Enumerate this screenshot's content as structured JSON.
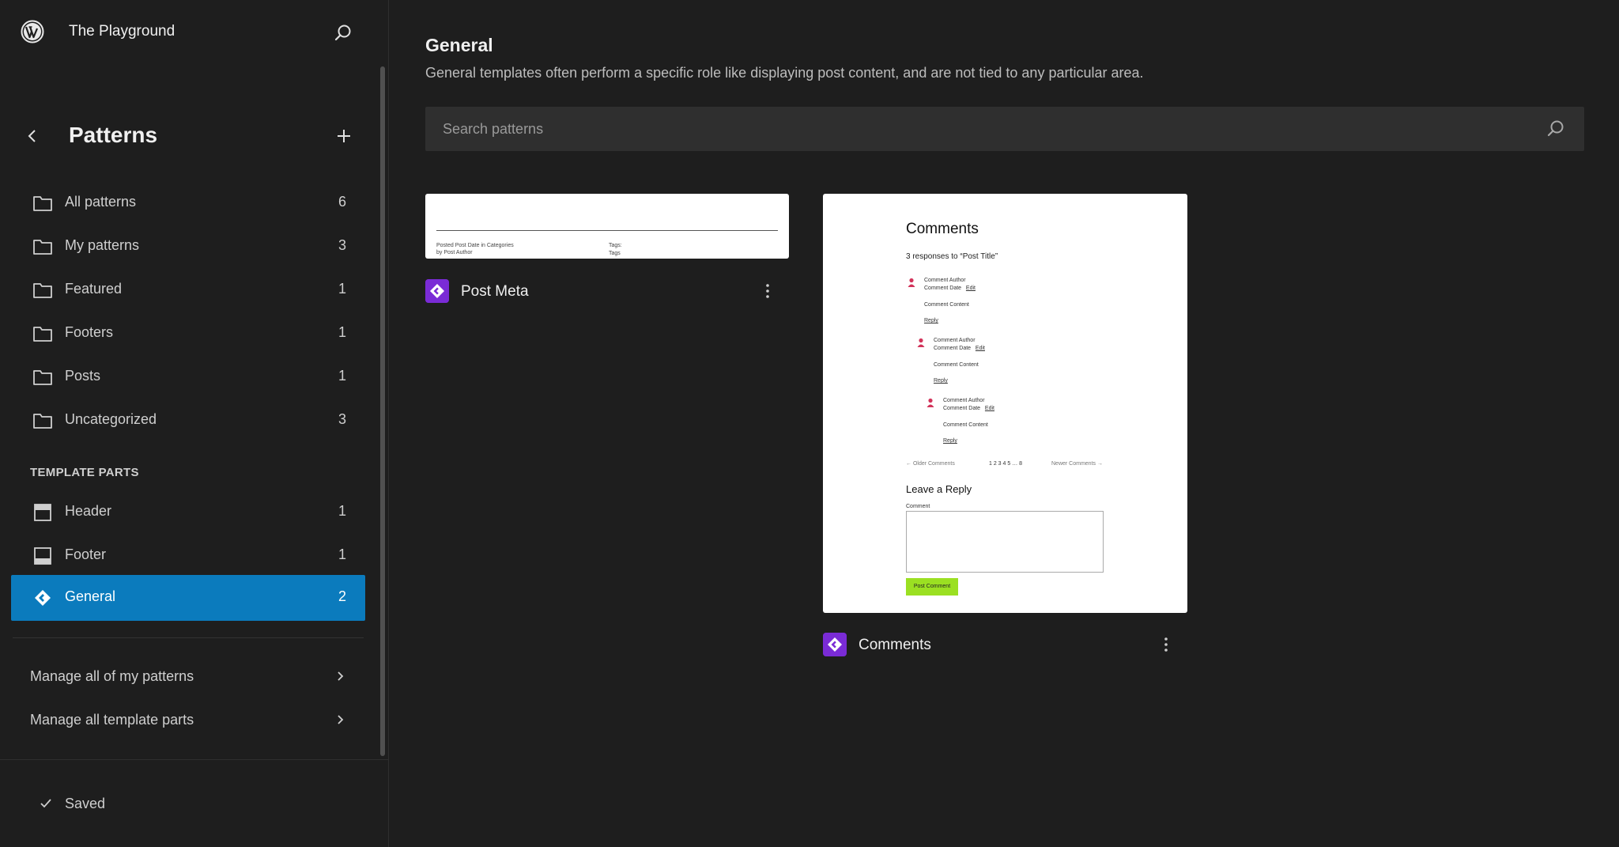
{
  "site": {
    "title": "The Playground"
  },
  "panel": {
    "title": "Patterns"
  },
  "nav": {
    "items": [
      {
        "label": "All patterns",
        "count": "6"
      },
      {
        "label": "My patterns",
        "count": "3"
      },
      {
        "label": "Featured",
        "count": "1"
      },
      {
        "label": "Footers",
        "count": "1"
      },
      {
        "label": "Posts",
        "count": "1"
      },
      {
        "label": "Uncategorized",
        "count": "3"
      }
    ],
    "template_parts_heading": "TEMPLATE PARTS",
    "template_parts": [
      {
        "label": "Header",
        "count": "1"
      },
      {
        "label": "Footer",
        "count": "1"
      },
      {
        "label": "General",
        "count": "2",
        "active": true
      }
    ],
    "manage": [
      {
        "label": "Manage all of my patterns"
      },
      {
        "label": "Manage all template parts"
      }
    ]
  },
  "status": {
    "saved_label": "Saved"
  },
  "main": {
    "title": "General",
    "description": "General templates often perform a specific role like displaying post content, and are not tied to any particular area.",
    "search_placeholder": "Search patterns",
    "cards": [
      {
        "title": "Post Meta",
        "preview": {
          "posted": "Posted",
          "post_date": "Post Date",
          "in": "in",
          "categories": "Categories",
          "by": "by",
          "post_author": "Post Author",
          "tags1": "Tags:",
          "tags2": "Tags"
        }
      },
      {
        "title": "Comments",
        "preview": {
          "heading": "Comments",
          "responses": "3 responses to “Post Title”",
          "comments": [
            {
              "author": "Comment Author",
              "date": "Comment Date",
              "edit": "Edit",
              "content": "Comment Content",
              "reply": "Reply"
            },
            {
              "author": "Comment Author",
              "date": "Comment Date",
              "edit": "Edit",
              "content": "Comment Content",
              "reply": "Reply"
            },
            {
              "author": "Comment Author",
              "date": "Comment Date",
              "edit": "Edit",
              "content": "Comment Content",
              "reply": "Reply"
            }
          ],
          "older": "← Older Comments",
          "pages": "1 2 3 4 5 … 8",
          "newer": "Newer Comments →",
          "leave_reply": "Leave a Reply",
          "comment_label": "Comment",
          "post_button": "Post Comment"
        }
      }
    ]
  },
  "colors": {
    "background": "#1e1e1e",
    "accent": "#0b7bbd",
    "pattern_icon": "#7a2bd6",
    "search_bg": "#2f2f2f",
    "post_button": "#9be022"
  },
  "icons": {
    "logo": "wordpress-logo",
    "hub_search": "search-icon",
    "back": "chevron-left-icon",
    "add": "plus-icon",
    "folder": "folder-icon",
    "header": "header-template-icon",
    "footer": "footer-template-icon",
    "pattern": "symbol-icon",
    "more": "more-vertical-icon",
    "check": "check-icon"
  }
}
